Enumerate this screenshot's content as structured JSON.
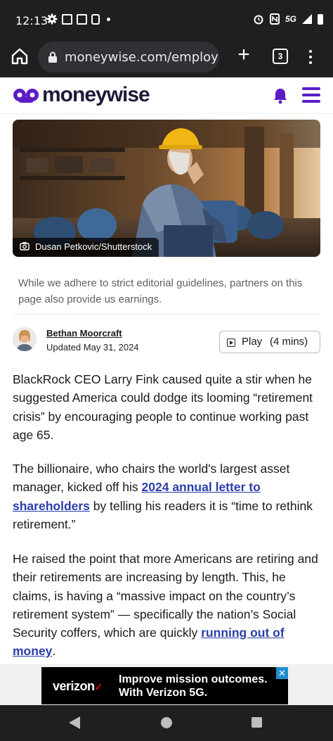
{
  "status_bar": {
    "time": "12:13",
    "network": "5G",
    "icons": [
      "settings-icon",
      "gallery-icon",
      "gallery-icon",
      "device-icon",
      "alarm-icon",
      "nfc-icon",
      "signal-icon",
      "battery-icon"
    ]
  },
  "browser": {
    "url": "moneywise.com/employm",
    "tab_count": "3"
  },
  "site": {
    "logo_text": "moneywise",
    "brand_color": "#5b1cc6"
  },
  "hero": {
    "credit": "Dusan Petkovic/Shutterstock"
  },
  "disclaimer": "While we adhere to strict editorial guidelines, partners on this page also provide us earnings.",
  "author": {
    "name": "Bethan Moorcraft",
    "updated": "Updated May 31, 2024"
  },
  "play": {
    "label": "Play",
    "duration": "(4 mins)"
  },
  "article": {
    "p1": "BlackRock CEO Larry Fink caused quite a stir when he suggested America could dodge its looming “retirement crisis” by encouraging people to continue working past age 65.",
    "p2_before": "The billionaire, who chairs the world's largest asset manager, kicked off his ",
    "p2_link": "2024 annual letter to shareholders",
    "p2_after": " by telling his readers it is “time to rethink retirement.”",
    "p3_before": "He raised the point that more Americans are retiring and their retirements are increasing by length. This, he claims, is having a “massive impact on the country’s retirement system” — specifically the nation’s Social Security coffers, which are quickly ",
    "p3_link": "running out of money",
    "p3_after": ".",
    "link_color": "#2b3ea9"
  },
  "ad": {
    "brand": "verizon",
    "brand_mark": "✓",
    "line1": "Improve mission outcomes.",
    "line2": "With Verizon 5G."
  }
}
